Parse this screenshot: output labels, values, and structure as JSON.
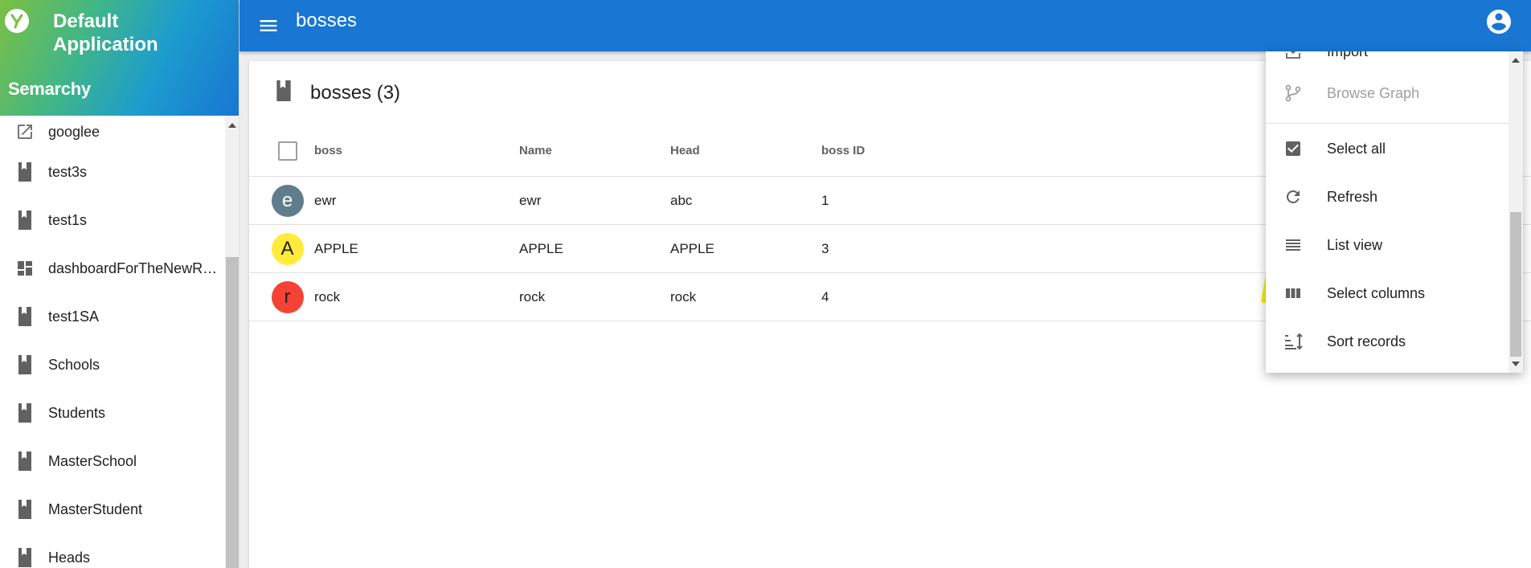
{
  "app": {
    "title": "Default Application",
    "brand": "Semarchy",
    "logo_icon": "semarchy-logo-icon"
  },
  "topbar": {
    "title": "bosses",
    "menu_icon": "hamburger-menu-icon",
    "account_icon": "account-circle-icon",
    "color": "#1976d2"
  },
  "sidebar": {
    "items": [
      {
        "label": "googlee",
        "icon": "open-in-new-icon"
      },
      {
        "label": "test3s",
        "icon": "book-icon"
      },
      {
        "label": "test1s",
        "icon": "book-icon"
      },
      {
        "label": "dashboardForTheNewRev...",
        "icon": "dashboard-icon"
      },
      {
        "label": "test1SA",
        "icon": "book-icon"
      },
      {
        "label": "Schools",
        "icon": "book-icon"
      },
      {
        "label": "Students",
        "icon": "book-icon"
      },
      {
        "label": "MasterSchool",
        "icon": "book-icon"
      },
      {
        "label": "MasterStudent",
        "icon": "book-icon"
      },
      {
        "label": "Heads",
        "icon": "book-icon"
      }
    ]
  },
  "card": {
    "title": "bosses (3)",
    "icon": "book-icon"
  },
  "table": {
    "columns": [
      "boss",
      "Name",
      "Head",
      "boss ID"
    ],
    "rows": [
      {
        "avatar": "e",
        "avatar_color": "#607d8b",
        "avatar_text_color": "#ffffff",
        "boss": "ewr",
        "name": "ewr",
        "head": "abc",
        "boss_id": "1"
      },
      {
        "avatar": "A",
        "avatar_color": "#ffeb3b",
        "avatar_text_color": "#212121",
        "boss": "APPLE",
        "name": "APPLE",
        "head": "APPLE",
        "boss_id": "3"
      },
      {
        "avatar": "r",
        "avatar_color": "#f44336",
        "avatar_text_color": "#212121",
        "boss": "rock",
        "name": "rock",
        "head": "rock",
        "boss_id": "4"
      }
    ]
  },
  "dropdown": {
    "items": [
      {
        "label": "Import",
        "icon": "import-icon",
        "disabled": false
      },
      {
        "label": "Browse Graph",
        "icon": "graph-icon",
        "disabled": true
      },
      {
        "label": "Select all",
        "icon": "checkbox-checked-icon",
        "disabled": false
      },
      {
        "label": "Refresh",
        "icon": "refresh-icon",
        "disabled": false
      },
      {
        "label": "List view",
        "icon": "list-view-icon",
        "disabled": false
      },
      {
        "label": "Select columns",
        "icon": "columns-icon",
        "disabled": false,
        "highlighted": true
      },
      {
        "label": "Sort records",
        "icon": "sort-icon",
        "disabled": false
      }
    ],
    "highlight_color": "#f6ee12"
  }
}
